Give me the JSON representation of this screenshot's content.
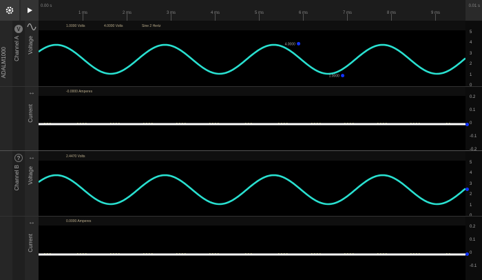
{
  "toolbar": {
    "settings_icon": "gear-icon",
    "play_icon": "play-icon",
    "start_label": "0.00 s",
    "end_label": "0.01 s",
    "time_labels": [
      "1 ms",
      "2 ms",
      "3 ms",
      "4 ms",
      "5 ms",
      "6 ms",
      "7 ms",
      "8 ms",
      "9 ms"
    ]
  },
  "device": {
    "name": "ADALM1000"
  },
  "channel_a": {
    "label": "Channel A",
    "badge": "V",
    "voltage": {
      "label": "Voltage",
      "readouts": [
        "1.0000 Volts",
        "4.0000 Volts",
        "Sine 2 Hertz"
      ],
      "ticks": [
        "5",
        "4",
        "3",
        "2",
        "1",
        "0"
      ],
      "markers": [
        {
          "label": "4.0000",
          "time_ms": 5.9,
          "value": 4.0
        },
        {
          "label": "1.0000",
          "time_ms": 6.9,
          "value": 1.0
        }
      ]
    },
    "current": {
      "label": "Current",
      "readouts": [
        "-0.0000 Amperes"
      ],
      "ticks": [
        "0.2",
        "0.1",
        "0",
        "-0.1",
        "-0.2"
      ]
    }
  },
  "channel_b": {
    "label": "Channel B",
    "badge": "?",
    "voltage": {
      "label": "Voltage",
      "readouts": [
        "2.4470 Volts"
      ],
      "ticks": [
        "5",
        "4",
        "3",
        "2",
        "1",
        "0"
      ]
    },
    "current": {
      "label": "Current",
      "readouts": [
        "0.0000 Amperes"
      ],
      "ticks": [
        "0.2",
        "0.1",
        "0",
        "-0.1"
      ]
    }
  },
  "colors": {
    "voltage_trace": "#29e0d0",
    "current_trace": "#ffffff",
    "marker": "#1133ff"
  }
}
